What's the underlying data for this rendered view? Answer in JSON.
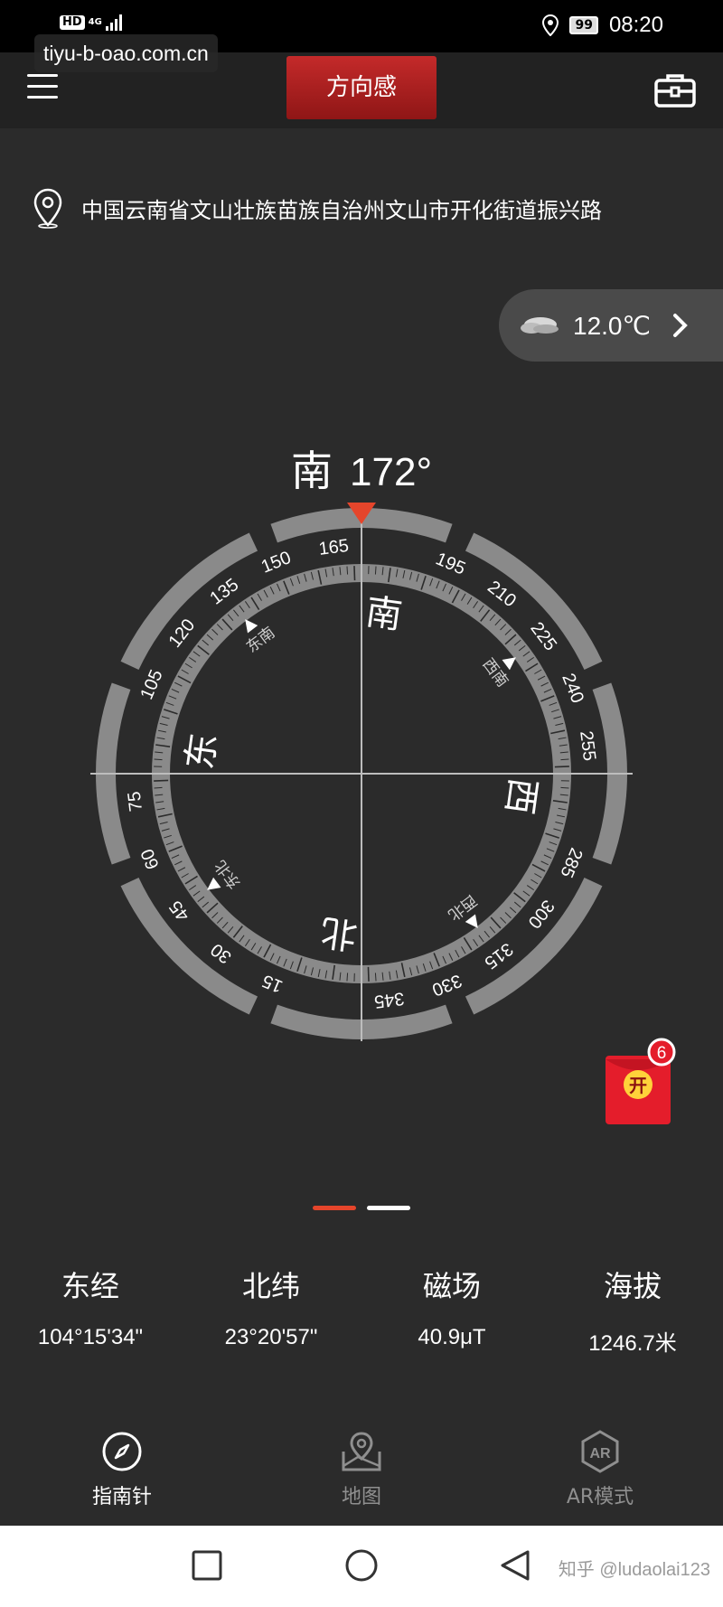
{
  "status_bar": {
    "hd": "HD",
    "network": "4G",
    "battery": "99",
    "time": "08:20"
  },
  "watermark_top": "tiyu-b-oao.com.cn",
  "header": {
    "title": "方向感"
  },
  "location": {
    "address": "中国云南省文山壮族苗族自治州文山市开化街道振兴路"
  },
  "weather": {
    "temperature": "12.0℃"
  },
  "heading": {
    "direction": "南",
    "degrees": "172°"
  },
  "compass": {
    "rotation_deg": 172,
    "accent_color": "#e5452b",
    "cardinals": [
      {
        "label": "北",
        "bearing": 0
      },
      {
        "label": "东",
        "bearing": 90
      },
      {
        "label": "南",
        "bearing": 180
      },
      {
        "label": "西",
        "bearing": 270
      }
    ],
    "intercardinals": [
      {
        "label": "东北",
        "bearing": 45
      },
      {
        "label": "东南",
        "bearing": 135
      },
      {
        "label": "西南",
        "bearing": 225
      },
      {
        "label": "西北",
        "bearing": 315
      }
    ],
    "numbers": [
      "15",
      "30",
      "45",
      "60",
      "75",
      "105",
      "120",
      "135",
      "150",
      "165",
      "195",
      "210",
      "225",
      "240",
      "255",
      "285",
      "300",
      "315",
      "330",
      "345"
    ]
  },
  "red_packet": {
    "label": "开",
    "badge": "6"
  },
  "pager": {
    "pages": 2,
    "active": 1
  },
  "stats": [
    {
      "label": "东经",
      "value": "104°15'34\""
    },
    {
      "label": "北纬",
      "value": "23°20'57\""
    },
    {
      "label": "磁场",
      "value": "40.9μT"
    },
    {
      "label": "海拔",
      "value": "1246.7米"
    }
  ],
  "tabs": [
    {
      "label": "指南针",
      "icon": "compass-icon",
      "active": true
    },
    {
      "label": "地图",
      "icon": "map-icon",
      "active": false
    },
    {
      "label": "AR模式",
      "icon": "ar-icon",
      "active": false,
      "icon_text": "AR"
    }
  ],
  "watermark_bottom": "知乎 @ludaolai123"
}
